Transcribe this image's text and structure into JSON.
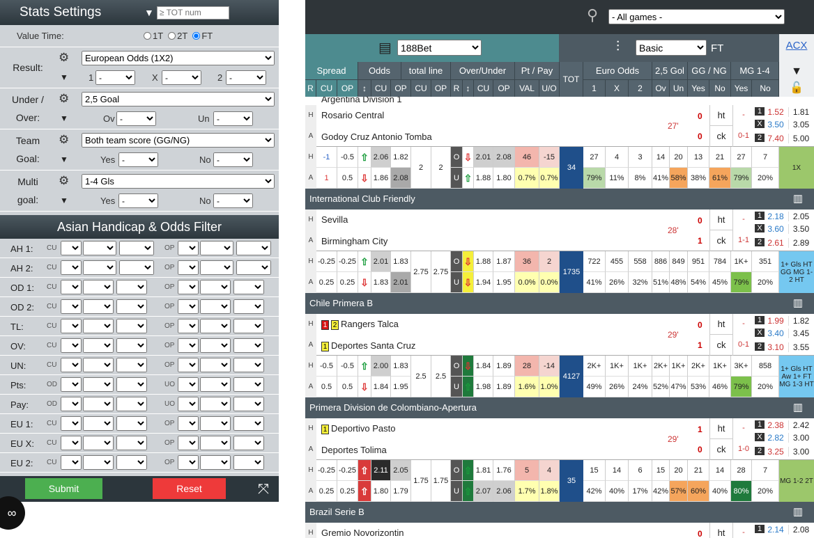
{
  "left": {
    "title": "Stats Settings",
    "tot_placeholder": "≥ TOT num",
    "value_time": {
      "label": "Value Time:",
      "options": [
        "1T",
        "2T",
        "FT"
      ],
      "selected": "FT"
    },
    "result": {
      "label": "Result:",
      "select": "European Odds (1X2)",
      "s1": "1",
      "sx": "X",
      "s2": "2",
      "v": "-"
    },
    "underover": {
      "l1": "Under /",
      "l2": "Over:",
      "select": "2,5 Goal",
      "a": "Ov",
      "b": "Un",
      "v": "-"
    },
    "teamgoal": {
      "l1": "Team",
      "l2": "Goal:",
      "select": "Both team score (GG/NG)",
      "a": "Yes",
      "b": "No",
      "v": "-"
    },
    "multigoal": {
      "l1": "Multi",
      "l2": "goal:",
      "select": "1-4 Gls",
      "a": "Yes",
      "b": "No",
      "v": "-"
    },
    "ah_title": "Asian Handicap & Odds Filter",
    "filters": [
      {
        "label": "AH 1:",
        "c1": "CU",
        "c2": "OP"
      },
      {
        "label": "AH 2:",
        "c1": "CU",
        "c2": "OP"
      },
      {
        "label": "OD 1:",
        "c1": "CU",
        "c2": "OP"
      },
      {
        "label": "OD 2:",
        "c1": "CU",
        "c2": "OP"
      },
      {
        "label": "TL:",
        "c1": "CU",
        "c2": "OP"
      },
      {
        "label": "OV:",
        "c1": "CU",
        "c2": "OP"
      },
      {
        "label": "UN:",
        "c1": "CU",
        "c2": "OP"
      },
      {
        "label": "Pts:",
        "c1": "OD",
        "c2": "UO"
      },
      {
        "label": "Pay:",
        "c1": "OD",
        "c2": "UO"
      },
      {
        "label": "EU 1:",
        "c1": "CU",
        "c2": "OP"
      },
      {
        "label": "EU X:",
        "c1": "CU",
        "c2": "OP"
      },
      {
        "label": "EU 2:",
        "c1": "CU",
        "c2": "OP"
      }
    ],
    "submit": "Submit",
    "reset": "Reset",
    "cc": "∞"
  },
  "right": {
    "games_select": "- All games -",
    "bookmaker": "188Bet",
    "view": "Basic",
    "ft": "FT",
    "acx": "ACX",
    "groups": [
      "Spread",
      "Odds",
      "total line",
      "Over/Under",
      "Pt / Pay",
      "TOT",
      "Euro Odds",
      "2,5 Gol",
      "GG / NG",
      "MG 1-4"
    ],
    "subs": [
      "R",
      "CU",
      "OP",
      "↕",
      "CU",
      "OP",
      "CU",
      "OP",
      "R",
      "↕",
      "CU",
      "OP",
      "VAL",
      "U/O",
      "1",
      "X",
      "2",
      "Ov",
      "Un",
      "Yes",
      "No",
      "Yes",
      "No"
    ],
    "top_cut": "Argentina Division 1",
    "matches": [
      {
        "league": "",
        "home": "Rosario Central",
        "away": "Godoy Cruz Antonio Tomba",
        "minute": "27'",
        "sh": "0",
        "sa": "0",
        "ht1": "ht",
        "ht2": "ck",
        "hs1": "-",
        "hs2": "0-1",
        "o": [
          [
            "1",
            "1.52",
            "1.81"
          ],
          [
            "X",
            "3.50",
            "3.05"
          ],
          [
            "2",
            "7.40",
            "5.00"
          ]
        ],
        "odds": {
          "hr": "-1",
          "ho": "-0.5",
          "ar": "1",
          "ao": "0.5",
          "o1h": "2.06",
          "o2h": "1.82",
          "o1a": "1.86",
          "o2a": "2.08",
          "tl1": "2",
          "tl2": "2",
          "ouh1": "2.01",
          "ouh2": "2.08",
          "oua1": "1.88",
          "oua2": "1.80",
          "pt1": "46",
          "pt2": "-15",
          "pa1": "0.7%",
          "pa2": "0.7%",
          "tot": "34",
          "v": [
            "27",
            "4",
            "3",
            "14",
            "20",
            "13",
            "21",
            "27",
            "7"
          ],
          "p": [
            "79%",
            "11%",
            "8%",
            "41%",
            "58%",
            "38%",
            "61%",
            "79%",
            "20%"
          ],
          "last": "1X"
        }
      },
      {
        "league": "International Club Friendly",
        "home": "Sevilla",
        "away": "Birmingham City",
        "minute": "28'",
        "sh": "0",
        "sa": "1",
        "ht1": "ht",
        "ht2": "ck",
        "hs1": "-",
        "hs2": "1-1",
        "o": [
          [
            "1",
            "2.18",
            "2.05"
          ],
          [
            "X",
            "3.60",
            "3.50"
          ],
          [
            "2",
            "2.61",
            "2.89"
          ]
        ],
        "odds": {
          "hr": "-0.25",
          "ho": "-0.25",
          "ar": "0.25",
          "ao": "0.25",
          "o1h": "2.01",
          "o2h": "1.83",
          "o1a": "1.83",
          "o2a": "2.01",
          "tl1": "2.75",
          "tl2": "2.75",
          "ouh1": "1.88",
          "ouh2": "1.87",
          "oua1": "1.94",
          "oua2": "1.95",
          "pt1": "36",
          "pt2": "2",
          "pa1": "0.0%",
          "pa2": "0.0%",
          "tot": "1735",
          "v": [
            "722",
            "455",
            "558",
            "886",
            "849",
            "951",
            "784",
            "1K+",
            "351"
          ],
          "p": [
            "41%",
            "26%",
            "32%",
            "51%",
            "48%",
            "54%",
            "45%",
            "79%",
            "20%"
          ],
          "last": "1+ Gls HT GG MG 1-2 HT"
        }
      },
      {
        "league": "Chile Primera B",
        "home": "Rangers Talca",
        "away": "Deportes Santa Cruz",
        "minute": "29'",
        "sh": "0",
        "sa": "1",
        "ht1": "ht",
        "ht2": "ck",
        "hs1": "-",
        "hs2": "0-1",
        "o": [
          [
            "1",
            "1.99",
            "1.82"
          ],
          [
            "X",
            "3.40",
            "3.45"
          ],
          [
            "2",
            "3.10",
            "3.55"
          ]
        ],
        "hc": [
          "1",
          "2"
        ],
        "ac": [
          "1"
        ],
        "odds": {
          "hr": "-0.5",
          "ho": "-0.5",
          "ar": "0.5",
          "ao": "0.5",
          "o1h": "2.00",
          "o2h": "1.83",
          "o1a": "1.84",
          "o2a": "1.95",
          "tl1": "2.5",
          "tl2": "2.5",
          "ouh1": "1.84",
          "ouh2": "1.89",
          "oua1": "1.98",
          "oua2": "1.89",
          "pt1": "28",
          "pt2": "-14",
          "pa1": "1.6%",
          "pa2": "1.0%",
          "tot": "4127",
          "v": [
            "2K+",
            "1K+",
            "1K+",
            "2K+",
            "1K+",
            "2K+",
            "1K+",
            "3K+",
            "858"
          ],
          "p": [
            "49%",
            "26%",
            "24%",
            "52%",
            "47%",
            "53%",
            "46%",
            "79%",
            "20%"
          ],
          "last": "1+ Gls HT Aw 1+ FT MG 1-3 HT"
        }
      },
      {
        "league": "Primera Division de Colombiano-Apertura",
        "home": "Deportivo Pasto",
        "away": "Deportes Tolima",
        "minute": "29'",
        "sh": "1",
        "sa": "0",
        "ht1": "ht",
        "ht2": "ck",
        "hs1": "-",
        "hs2": "1-0",
        "o": [
          [
            "1",
            "2.38",
            "2.42"
          ],
          [
            "X",
            "2.82",
            "3.00"
          ],
          [
            "2",
            "3.25",
            "3.00"
          ]
        ],
        "hc": [
          "1"
        ],
        "odds": {
          "hr": "-0.25",
          "ho": "-0.25",
          "ar": "0.25",
          "ao": "0.25",
          "o1h": "2.11",
          "o2h": "2.05",
          "o1a": "1.80",
          "o2a": "1.79",
          "tl1": "1.75",
          "tl2": "1.75",
          "ouh1": "1.81",
          "ouh2": "1.76",
          "oua1": "2.07",
          "oua2": "2.06",
          "pt1": "5",
          "pt2": "4",
          "pa1": "1.7%",
          "pa2": "1.8%",
          "tot": "35",
          "v": [
            "15",
            "14",
            "6",
            "15",
            "20",
            "21",
            "14",
            "28",
            "7"
          ],
          "p": [
            "42%",
            "40%",
            "17%",
            "42%",
            "57%",
            "60%",
            "40%",
            "80%",
            "20%"
          ],
          "last": "MG 1-2 2T"
        }
      }
    ],
    "next": {
      "league": "Brazil Serie B",
      "home": "Gremio Novorizontin",
      "sh": "0",
      "ht1": "ht",
      "hs1": "-",
      "o": [
        "1",
        "2.14",
        "2.08"
      ]
    }
  }
}
